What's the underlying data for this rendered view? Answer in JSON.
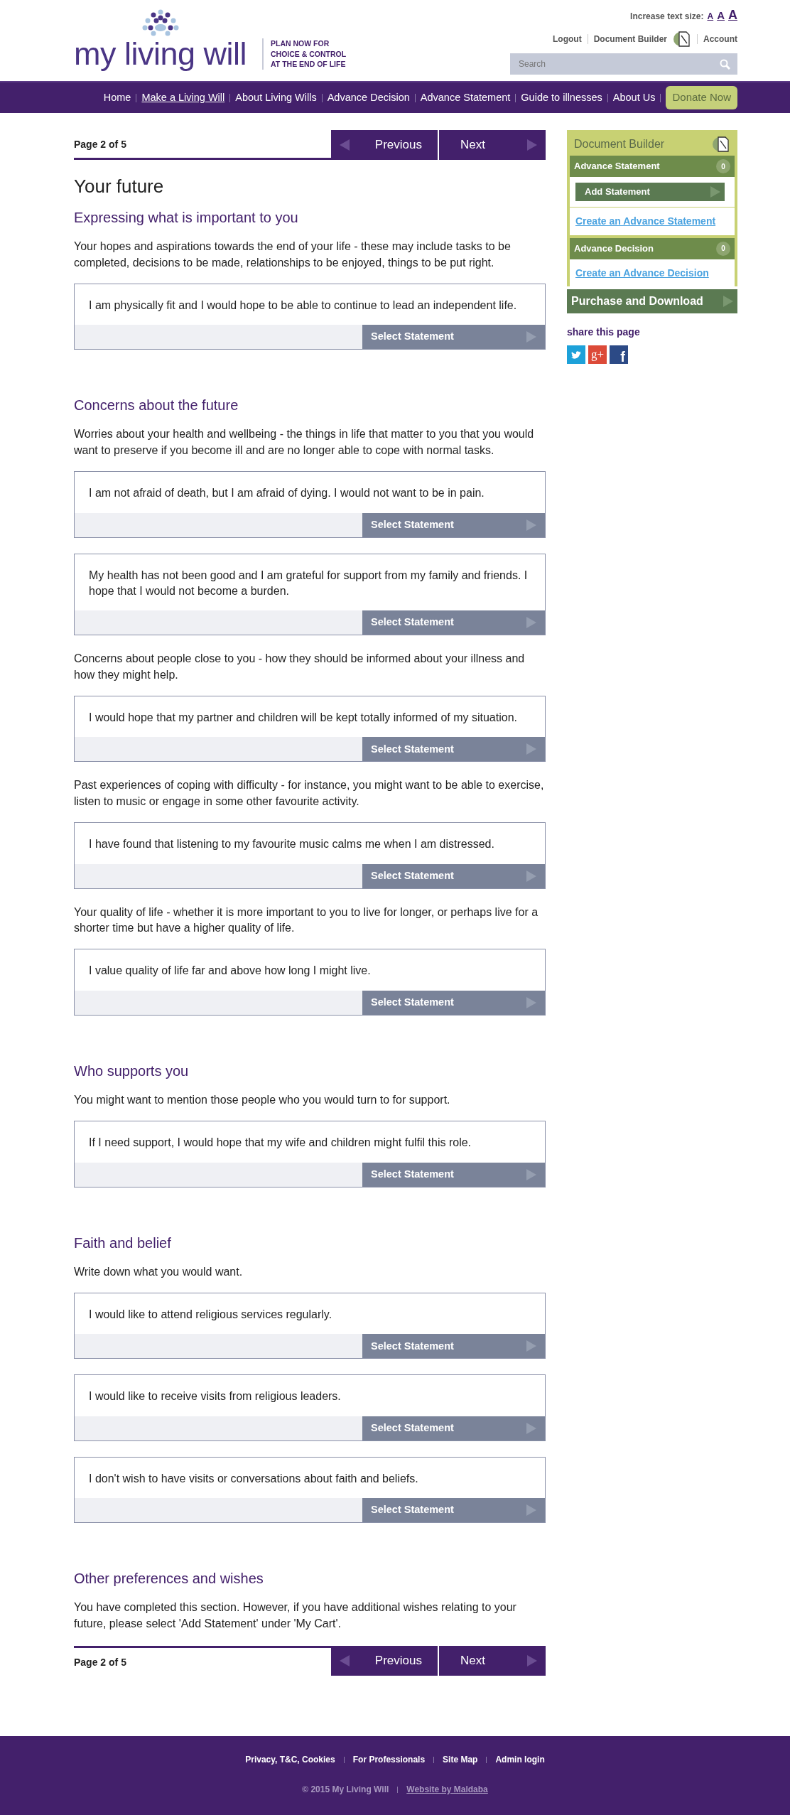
{
  "header": {
    "logo": "my living will",
    "tagline": "PLAN NOW FOR CHOICE & CONTROL AT THE END OF LIFE",
    "text_size_label": "Increase text size:",
    "text_size_options": [
      "A",
      "A",
      "A"
    ],
    "links": [
      "Logout",
      "Document Builder",
      "Account"
    ],
    "search": {
      "placeholder": "Search"
    }
  },
  "nav": {
    "items": [
      {
        "label": "Home",
        "selected": false
      },
      {
        "label": "Make a Living Will",
        "selected": true
      },
      {
        "label": "About Living Wills",
        "selected": false
      },
      {
        "label": "Advance Decision",
        "selected": false
      },
      {
        "label": "Advance Statement",
        "selected": false
      },
      {
        "label": "Guide to illnesses",
        "selected": false
      },
      {
        "label": "About Us",
        "selected": false
      }
    ],
    "donate": "Donate Now"
  },
  "pager_top": {
    "page": "Page 2 of 5",
    "previous": "Previous",
    "next": "Next"
  },
  "title": "Your future",
  "sections": [
    {
      "heading": "Expressing what is important to you",
      "blocks": [
        {
          "kind": "text",
          "text": "Your hopes and aspirations towards the end of your life - these may include tasks to be completed, decisions to be made, relationships to be enjoyed, things to be put right."
        },
        {
          "kind": "statement",
          "text": "I am physically fit and I would hope to be able to continue to lead an independent life.",
          "button": "Select Statement"
        }
      ]
    },
    {
      "heading": "Concerns about the future",
      "blocks": [
        {
          "kind": "text",
          "text": "Worries about your health and wellbeing - the things in life that matter to you that you would want to preserve if you become ill and are no longer able to cope with normal tasks."
        },
        {
          "kind": "statement",
          "text": "I am not afraid of death, but I am afraid of dying. I would not want to be in pain.",
          "button": "Select Statement"
        },
        {
          "kind": "statement",
          "text": "My health has not been good and I am grateful for support from my family and friends. I hope that I would not become a burden.",
          "button": "Select Statement"
        },
        {
          "kind": "text",
          "text": "Concerns about people close to you - how they should be informed about your illness and how they might help."
        },
        {
          "kind": "statement",
          "text": "I would hope that my partner and children will be kept totally informed of my situation.",
          "button": "Select Statement"
        },
        {
          "kind": "text",
          "text": "Past experiences of coping with difficulty - for instance, you might want to be able to exercise, listen to music or engage in some other favourite activity."
        },
        {
          "kind": "statement",
          "text": "I have found that listening to my favourite music calms me when I am distressed.",
          "button": "Select Statement"
        },
        {
          "kind": "text",
          "text": "Your quality of life - whether it is more important to you to live for longer, or perhaps live for a shorter time but have a higher quality of life."
        },
        {
          "kind": "statement",
          "text": "I value quality of life far and above how long I might live.",
          "button": "Select Statement"
        }
      ]
    },
    {
      "heading": "Who supports you",
      "blocks": [
        {
          "kind": "text",
          "text": "You might want to mention those people who you would turn to for support."
        },
        {
          "kind": "statement",
          "text": "If I need support, I would hope that my wife and children might fulfil this role.",
          "button": "Select Statement"
        }
      ]
    },
    {
      "heading": "Faith and belief",
      "blocks": [
        {
          "kind": "text",
          "text": "Write down what you would want."
        },
        {
          "kind": "statement",
          "text": "I would like to attend religious services regularly.",
          "button": "Select Statement"
        },
        {
          "kind": "statement",
          "text": "I would like to receive visits from religious leaders.",
          "button": "Select Statement"
        },
        {
          "kind": "statement",
          "text": "I don't wish to have visits or conversations about faith and beliefs.",
          "button": "Select Statement"
        }
      ]
    },
    {
      "heading": "Other preferences and wishes",
      "blocks": [
        {
          "kind": "text",
          "text": "You have completed this section. However, if you have additional wishes relating to your future, please select 'Add Statement' under 'My Cart'."
        }
      ]
    }
  ],
  "pager_bottom": {
    "page": "Page 2 of 5",
    "previous": "Previous",
    "next": "Next"
  },
  "sidebar": {
    "title": "Document Builder",
    "groups": [
      {
        "heading": "Advance Statement",
        "count": "0",
        "button": "Add Statement",
        "link": "Create an Advance Statement"
      },
      {
        "heading": "Advance Decision",
        "count": "0",
        "link": "Create an Advance Decision"
      }
    ],
    "purchase": "Purchase and Download",
    "share_heading": "share this page",
    "share": [
      {
        "kind": "twitter"
      },
      {
        "kind": "googleplus",
        "text": "g+"
      },
      {
        "kind": "facebook",
        "text": "f"
      }
    ]
  },
  "footer": {
    "links": [
      "Privacy, T&C, Cookies",
      "For Professionals",
      "Site Map",
      "Admin login"
    ],
    "copyright": "© 2015 My Living Will",
    "credit": "Website by Maldaba"
  }
}
